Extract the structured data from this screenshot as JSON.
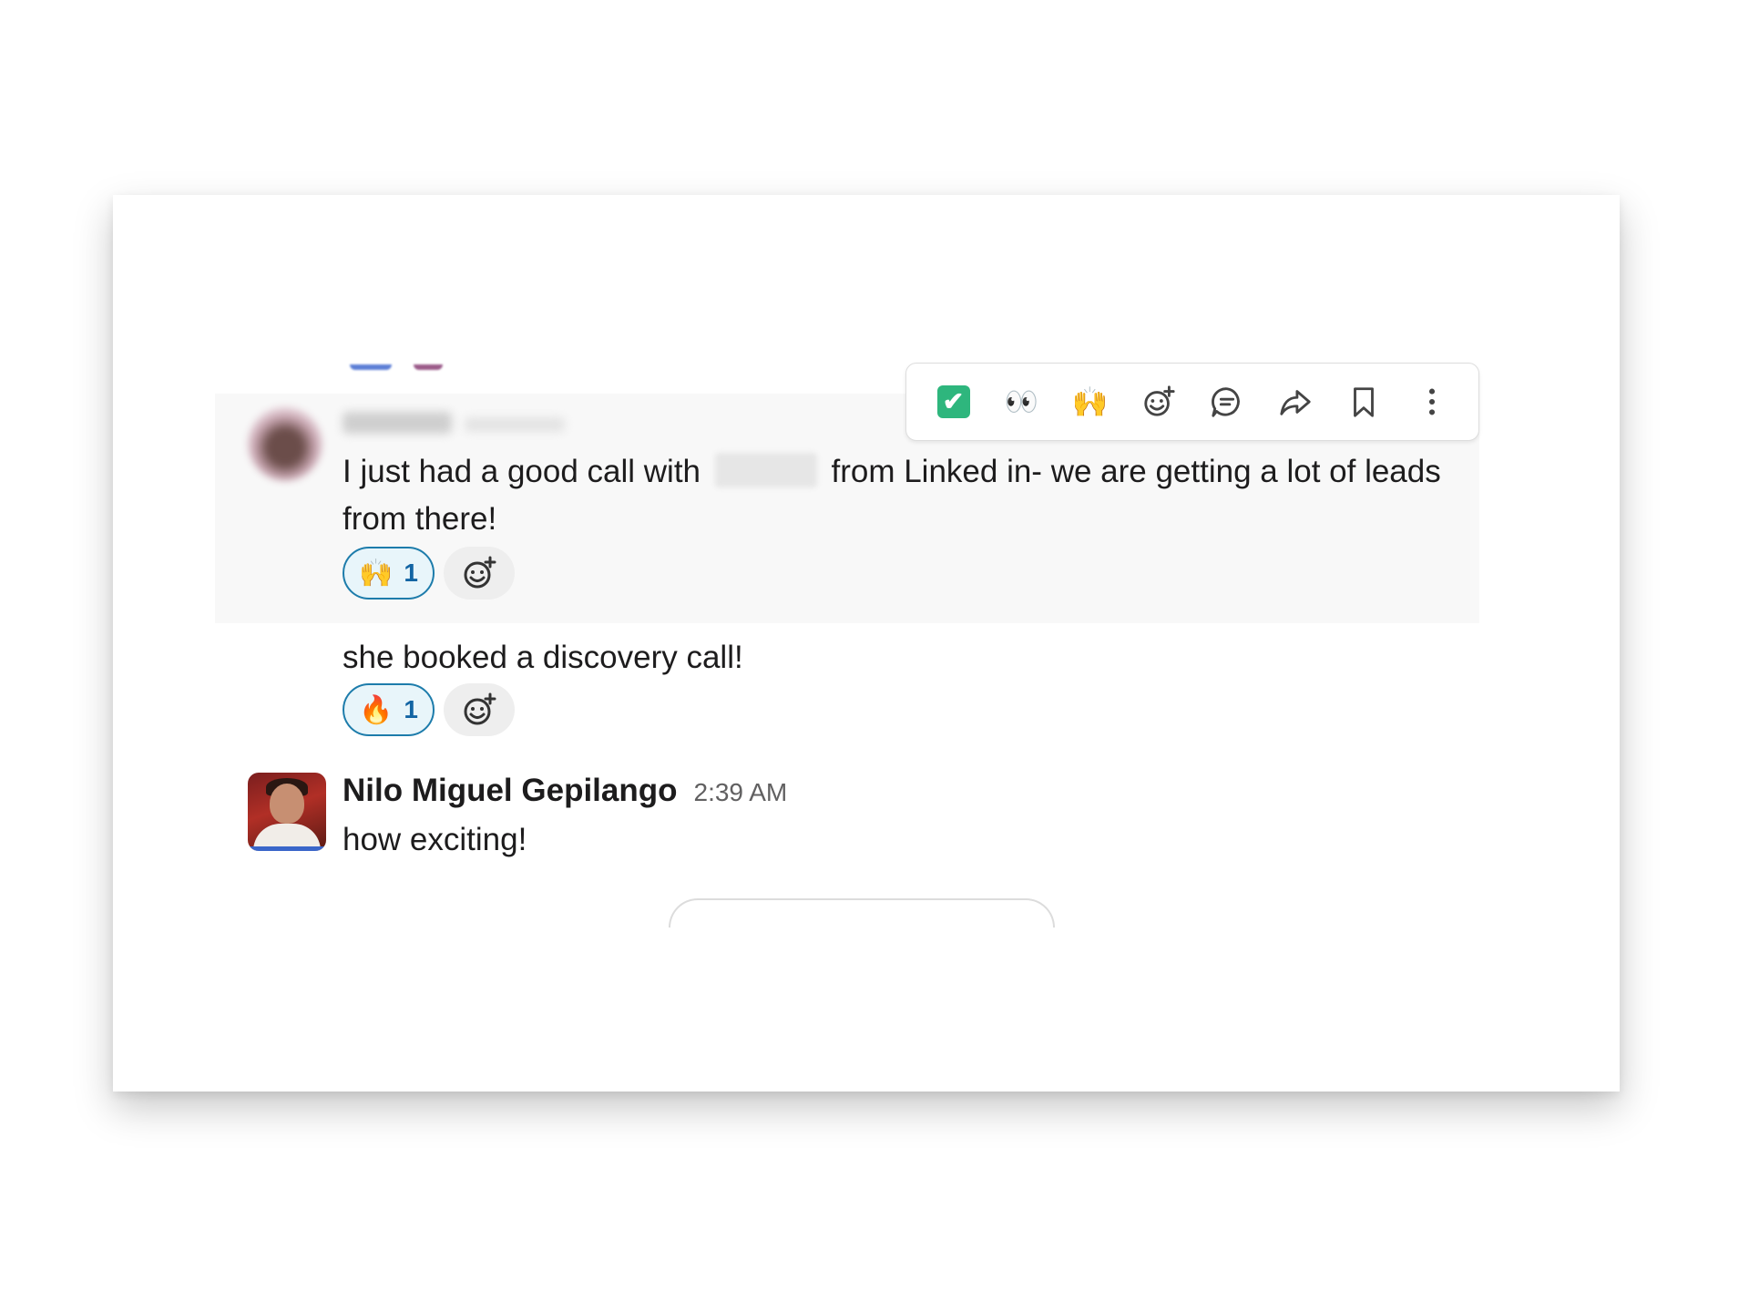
{
  "toolbar": {
    "actions": [
      {
        "name": "completed-reaction",
        "glyph": "✔"
      },
      {
        "name": "looking-reaction",
        "glyph": "👀"
      },
      {
        "name": "raised-hands-reaction",
        "glyph": "🙌"
      },
      {
        "name": "add-reaction",
        "glyph": ""
      },
      {
        "name": "reply-in-thread",
        "glyph": ""
      },
      {
        "name": "share-message",
        "glyph": ""
      },
      {
        "name": "save-for-later",
        "glyph": ""
      },
      {
        "name": "more-actions",
        "glyph": "⋮"
      }
    ]
  },
  "messages": [
    {
      "text_before": "I just had a good call with",
      "text_after": "from Linked in- we are getting a lot of leads from there!",
      "reaction": {
        "emoji": "🙌",
        "count": "1"
      }
    },
    {
      "text": "she booked a  discovery call!",
      "reaction": {
        "emoji": "🔥",
        "count": "1"
      }
    },
    {
      "sender": "Nilo Miguel Gepilango",
      "time": "2:39 AM",
      "text": "how exciting!"
    }
  ],
  "colors": {
    "accent": "#1264a3",
    "reaction_border": "#1d7cab",
    "reaction_bg": "#e8f5fa",
    "hover_bg": "#f8f8f8",
    "check_green": "#2eb67d"
  }
}
